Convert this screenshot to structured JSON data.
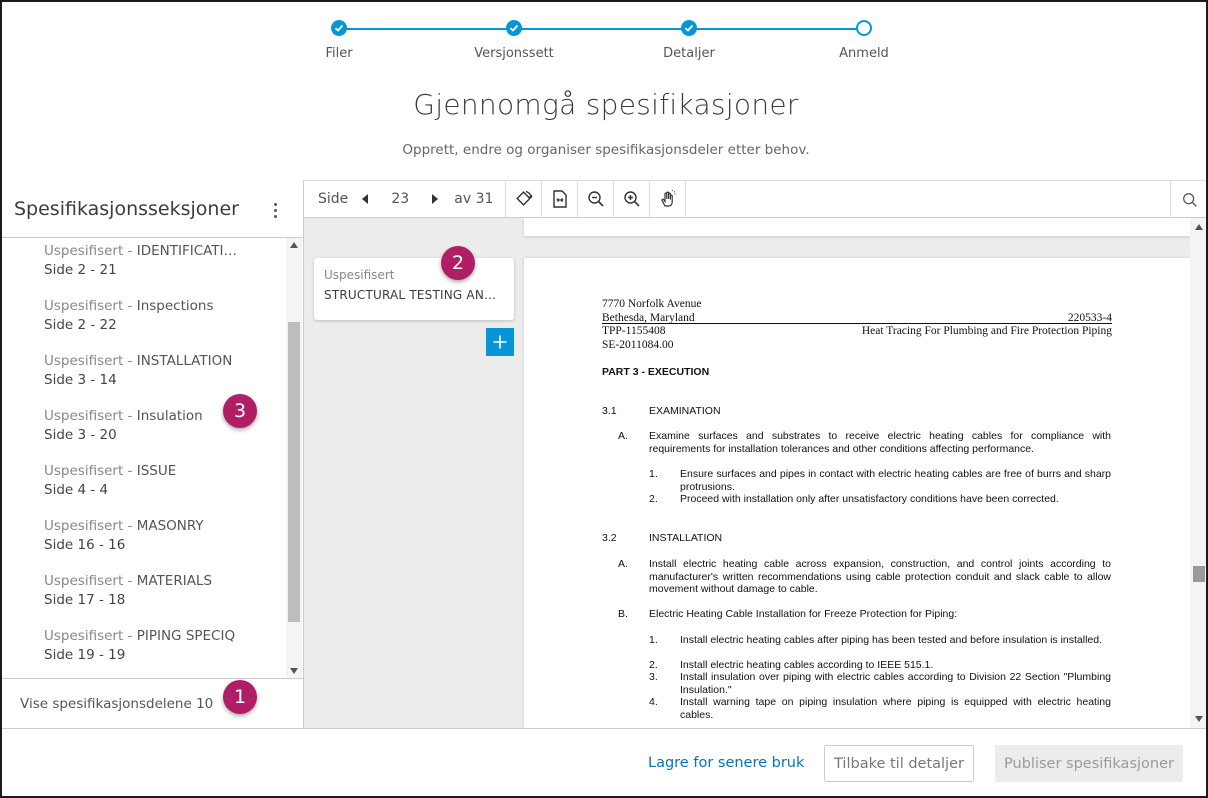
{
  "stepper": {
    "steps": [
      {
        "label": "Filer",
        "state": "done"
      },
      {
        "label": "Versjonssett",
        "state": "done"
      },
      {
        "label": "Detaljer",
        "state": "done"
      },
      {
        "label": "Anmeld",
        "state": "current"
      }
    ],
    "accent": "#0696d7"
  },
  "page": {
    "title": "Gjennomgå spesifikasjoner",
    "subtitle": "Opprett, endre og organiser spesifikasjonsdeler etter behov."
  },
  "sidebar": {
    "title": "Spesifikasjonsseksjoner",
    "items": [
      {
        "prefix": "Uspesifisert - ",
        "name": "IDENTIFICATI…",
        "pages": "Side 2 - 21"
      },
      {
        "prefix": "Uspesifisert - ",
        "name": "Inspections",
        "pages": "Side 2 - 22"
      },
      {
        "prefix": "Uspesifisert - ",
        "name": "INSTALLATION",
        "pages": "Side 3 - 14"
      },
      {
        "prefix": "Uspesifisert - ",
        "name": "Insulation",
        "pages": "Side 3 - 20"
      },
      {
        "prefix": "Uspesifisert - ",
        "name": "ISSUE",
        "pages": "Side 4 - 4"
      },
      {
        "prefix": "Uspesifisert - ",
        "name": "MASONRY",
        "pages": "Side 16 - 16"
      },
      {
        "prefix": "Uspesifisert - ",
        "name": "MATERIALS",
        "pages": "Side 17 - 18"
      },
      {
        "prefix": "Uspesifisert - ",
        "name": "PIPING SPECIQ",
        "pages": "Side 19 - 19"
      }
    ],
    "footer": "Vise spesifikasjonsdelene 10"
  },
  "badges": [
    "1",
    "2",
    "3"
  ],
  "badge_color": "#b01f66",
  "toolbar": {
    "page_word": "Side",
    "current_page": "23",
    "of_total": "av 31"
  },
  "card": {
    "label": "Uspesifisert",
    "title": "STRUCTURAL TESTING AND IN…"
  },
  "document": {
    "addr1": "7770 Norfolk Avenue",
    "addr2": "Bethesda, Maryland",
    "code": "220533-4",
    "proj": "TPP-1155408",
    "doc_title": "Heat Tracing For Plumbing and Fire Protection Piping",
    "se": "SE-2011084.00",
    "part": "PART 3 - EXECUTION",
    "s1_num": "3.1",
    "s1_title": "EXAMINATION",
    "s1_a_letter": "A.",
    "s1_a": "Examine surfaces and substrates to receive electric heating cables for compliance with requirements for installation tolerances and other conditions affecting performance.",
    "s1_a1_num": "1.",
    "s1_a1": "Ensure surfaces and pipes in contact with electric heating cables are free of burrs and sharp protrusions.",
    "s1_a2_num": "2.",
    "s1_a2": "Proceed with installation only after unsatisfactory conditions have been corrected.",
    "s2_num": "3.2",
    "s2_title": "INSTALLATION",
    "s2_a_letter": "A.",
    "s2_a": "Install electric heating cable across expansion, construction, and control joints according to manufacturer's written recommendations using cable protection conduit and slack cable to allow movement without damage to cable.",
    "s2_b_letter": "B.",
    "s2_b": "Electric Heating Cable Installation for Freeze Protection for Piping:",
    "s2_b1_num": "1.",
    "s2_b1": "Install electric heating cables after piping has been tested and before insulation is installed.",
    "s2_b2_num": "2.",
    "s2_b2": "Install electric heating cables according to IEEE 515.1.",
    "s2_b3_num": "3.",
    "s2_b3": "Install insulation over piping with electric cables according to Division 22 Section \"Plumbing Insulation.\"",
    "s2_b4_num": "4.",
    "s2_b4": "Install warning tape on piping insulation where piping is equipped with electric heating cables."
  },
  "footer": {
    "save_label": "Lagre for senere bruk",
    "back_label": "Tilbake til detaljer",
    "publish_label": "Publiser spesifikasjoner"
  }
}
